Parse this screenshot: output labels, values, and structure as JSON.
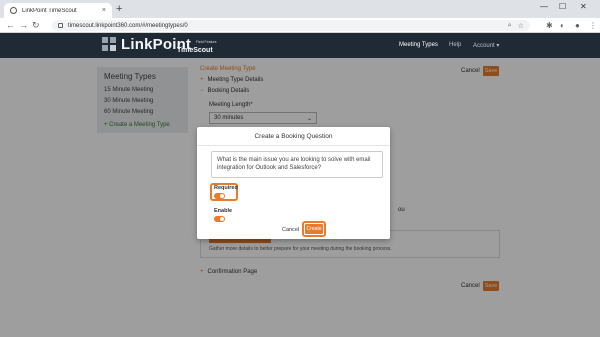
{
  "browser": {
    "tab_title": "LinkPoint TimeScout",
    "tab_close": "×",
    "new_tab": "+",
    "url": "timescout.linkpoint360.com/#/meetingtypes/0",
    "minimize": "—",
    "maximize": "☐",
    "close": "✕"
  },
  "app": {
    "logo_text": "LinkPoint",
    "logo_sub": "TimeScout",
    "logo_tag": "Field Feature",
    "nav": [
      "Meeting Types",
      "Help",
      "Account ▾"
    ]
  },
  "sidebar": {
    "title": "Meeting Types",
    "items": [
      "15 Minute Meeting",
      "30 Minute Meeting",
      "60 Minute Meeting",
      "+ Create a Meeting Type"
    ]
  },
  "main": {
    "title": "Create Meeting Type",
    "cancel": "Cancel",
    "save": "Save",
    "sections": {
      "meeting_type_details": "Meeting Type Details",
      "booking_details": "Booking Details",
      "confirmation_page": "Confirmation Page"
    },
    "meeting_length_label": "Meeting Length*",
    "meeting_length_value": "30 minutes",
    "partial_right_text": "ou",
    "box_description": "Gather more details to better prepare for your meeting during the booking process."
  },
  "modal": {
    "title": "Create a Booking Question",
    "question": "What is the main issue you are looking to solve with email integration for Outlook and Salesforce?",
    "required_label": "Required",
    "required_on": true,
    "enable_label": "Enable",
    "enable_on": true,
    "cancel": "Cancel",
    "create": "Create"
  },
  "colors": {
    "accent": "#e97b2a",
    "header_bg": "#1f2a35",
    "active_link": "#2e7d32"
  }
}
